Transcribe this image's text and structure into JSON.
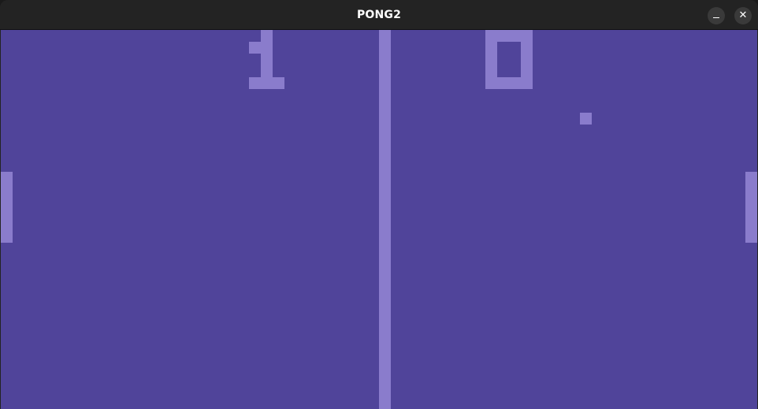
{
  "window": {
    "title": "PONG2",
    "minimize_icon": "minimize-icon",
    "close_icon": "close-icon"
  },
  "game": {
    "colors": {
      "court": "#50449a",
      "foreground": "#8a7ccc",
      "titlebar": "#232323"
    },
    "score": {
      "left": 1,
      "right": 0
    }
  }
}
